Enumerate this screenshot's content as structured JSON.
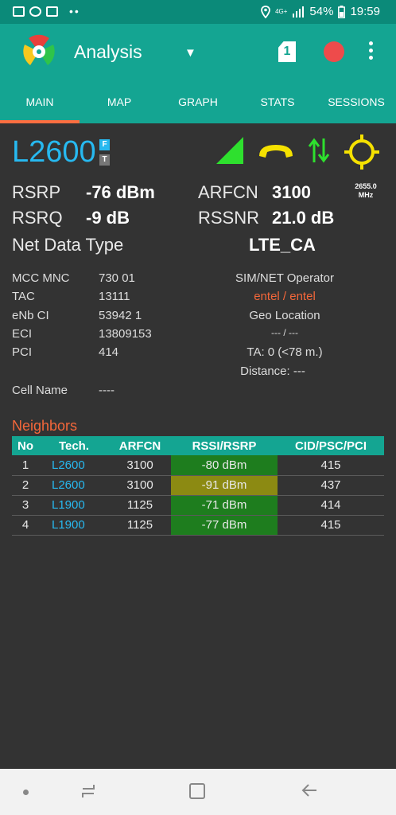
{
  "status_bar": {
    "network": "4G+",
    "battery": "54%",
    "time": "19:59",
    "dots": "••"
  },
  "toolbar": {
    "title": "Analysis",
    "sim_slot": "1"
  },
  "tabs": [
    "MAIN",
    "MAP",
    "GRAPH",
    "STATS",
    "SESSIONS"
  ],
  "serving": {
    "tech": "L2600",
    "badge_f": "F",
    "badge_t": "T",
    "rsrp_label": "RSRP",
    "rsrp": "-76 dBm",
    "arfcn_label": "ARFCN",
    "arfcn": "3100",
    "freq": "2655.0",
    "freq_unit": "MHz",
    "rsrq_label": "RSRQ",
    "rsrq": "-9 dB",
    "rssnr_label": "RSSNR",
    "rssnr": "21.0 dB",
    "net_data_label": "Net Data Type",
    "net_data": "LTE_CA"
  },
  "cell": {
    "mcc_mnc_label": "MCC MNC",
    "mcc_mnc": "730 01",
    "tac_label": "TAC",
    "tac": "13111",
    "enb_ci_label": "eNb CI",
    "enb_ci": "53942 1",
    "eci_label": "ECI",
    "eci": "13809153",
    "pci_label": "PCI",
    "pci": "414",
    "cell_name_label": "Cell Name",
    "cell_name": "----",
    "operator_label": "SIM/NET Operator",
    "operator": "entel / entel",
    "geo_label": "Geo Location",
    "geo": "--- / ---",
    "ta": "TA: 0 (<78 m.)",
    "distance": "Distance: ---"
  },
  "neighbors": {
    "title": "Neighbors",
    "columns": [
      "No",
      "Tech.",
      "ARFCN",
      "RSSI/RSRP",
      "CID/PSC/PCI"
    ],
    "rows": [
      {
        "no": "1",
        "tech": "L2600",
        "arfcn": "3100",
        "rsrp": "-80 dBm",
        "cid": "415",
        "level": "good"
      },
      {
        "no": "2",
        "tech": "L2600",
        "arfcn": "3100",
        "rsrp": "-91 dBm",
        "cid": "437",
        "level": "mid"
      },
      {
        "no": "3",
        "tech": "L1900",
        "arfcn": "1125",
        "rsrp": "-71 dBm",
        "cid": "414",
        "level": "good"
      },
      {
        "no": "4",
        "tech": "L1900",
        "arfcn": "1125",
        "rsrp": "-77 dBm",
        "cid": "415",
        "level": "good"
      }
    ]
  },
  "colors": {
    "primary": "#14a592",
    "status_bar": "#0b8a79",
    "accent": "#ff6e40",
    "tech_blue": "#27b9f0",
    "signal_good": "#1e7d1e",
    "signal_mid": "#8c8a12",
    "icon_yellow": "#f5e100",
    "icon_green": "#2ee02e"
  }
}
